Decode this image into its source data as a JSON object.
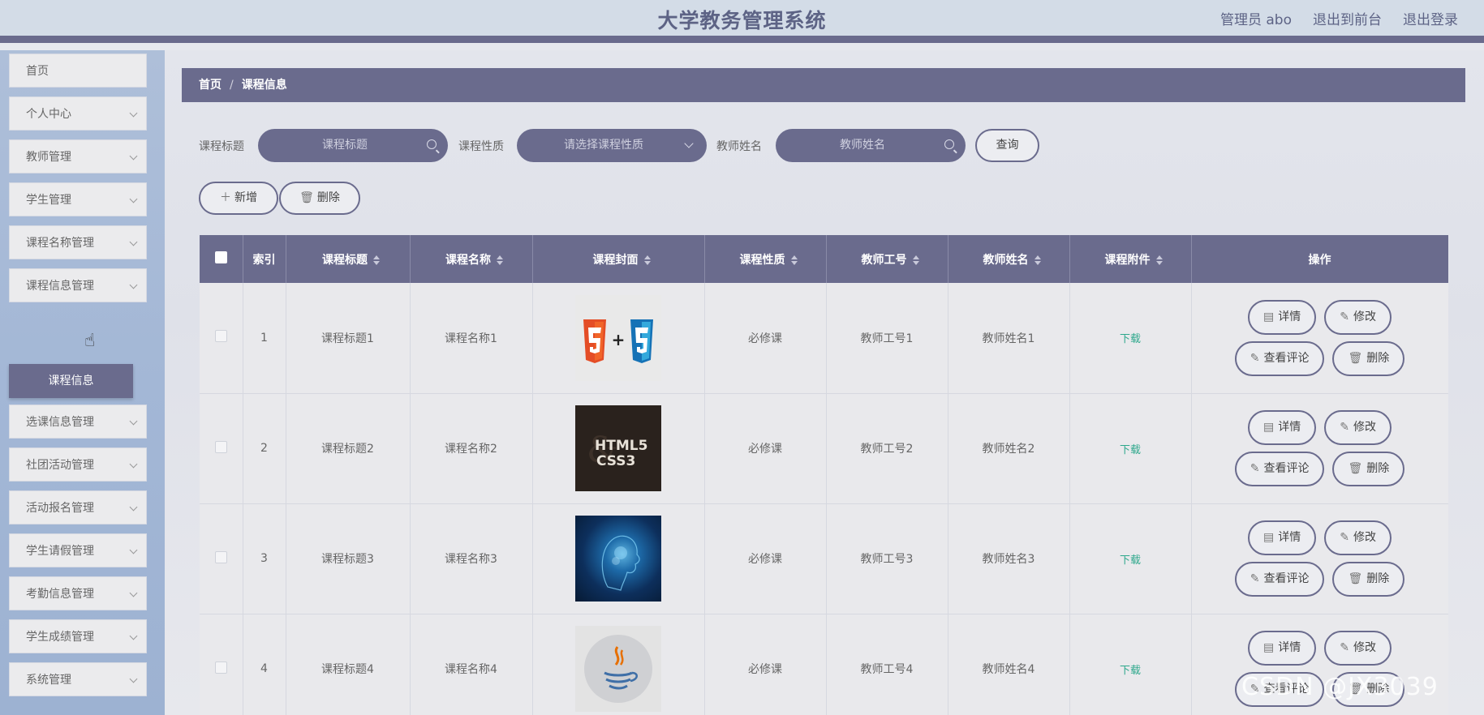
{
  "header": {
    "title": "大学教务管理系统",
    "links": [
      "管理员 abo",
      "退出到前台",
      "退出登录"
    ]
  },
  "sidebar": {
    "items": [
      {
        "label": "首页",
        "has_chevron": false
      },
      {
        "label": "个人中心",
        "has_chevron": true
      },
      {
        "label": "教师管理",
        "has_chevron": true
      },
      {
        "label": "学生管理",
        "has_chevron": true
      },
      {
        "label": "课程名称管理",
        "has_chevron": true
      },
      {
        "label": "课程信息管理",
        "has_chevron": true
      },
      {
        "label": "选课信息管理",
        "has_chevron": true
      },
      {
        "label": "社团活动管理",
        "has_chevron": true
      },
      {
        "label": "活动报名管理",
        "has_chevron": true
      },
      {
        "label": "学生请假管理",
        "has_chevron": true
      },
      {
        "label": "考勤信息管理",
        "has_chevron": true
      },
      {
        "label": "学生成绩管理",
        "has_chevron": true
      },
      {
        "label": "系统管理",
        "has_chevron": true
      }
    ],
    "active_sub": "课程信息"
  },
  "breadcrumb": {
    "home": "首页",
    "sep": "/",
    "current": "课程信息"
  },
  "filters": {
    "title_label": "课程标题",
    "title_placeholder": "课程标题",
    "type_label": "课程性质",
    "type_placeholder": "请选择课程性质",
    "teacher_label": "教师姓名",
    "teacher_placeholder": "教师姓名",
    "query_label": "查询"
  },
  "actions": {
    "add_label": "新增",
    "delete_label": "删除"
  },
  "table": {
    "headers": [
      "索引",
      "课程标题",
      "课程名称",
      "课程封面",
      "课程性质",
      "教师工号",
      "教师姓名",
      "课程附件",
      "操作"
    ],
    "rows": [
      {
        "index": "1",
        "title": "课程标题1",
        "name": "课程名称1",
        "cover": "html5-css3-logo",
        "type": "必修课",
        "teacher_no": "教师工号1",
        "teacher_name": "教师姓名1",
        "attachment": "下载"
      },
      {
        "index": "2",
        "title": "课程标题2",
        "name": "课程名称2",
        "cover": "html5-css3-dark",
        "cover_text1": "HTML5",
        "cover_text2": "CSS3",
        "type": "必修课",
        "teacher_no": "教师工号2",
        "teacher_name": "教师姓名2",
        "attachment": "下载"
      },
      {
        "index": "3",
        "title": "课程标题3",
        "name": "课程名称3",
        "cover": "ai-head",
        "type": "必修课",
        "teacher_no": "教师工号3",
        "teacher_name": "教师姓名3",
        "attachment": "下载"
      },
      {
        "index": "4",
        "title": "课程标题4",
        "name": "课程名称4",
        "cover": "java-logo",
        "type": "必修课",
        "teacher_no": "教师工号4",
        "teacher_name": "教师姓名4",
        "attachment": "下载"
      }
    ],
    "row_actions": {
      "detail": "详情",
      "edit": "修改",
      "comments": "查看评论",
      "delete": "删除"
    }
  },
  "watermark": "CSDN @JX3039",
  "colors": {
    "accent": "#6a6b8d",
    "download": "#2ea88c",
    "sidebar": "#a3b7d6"
  }
}
